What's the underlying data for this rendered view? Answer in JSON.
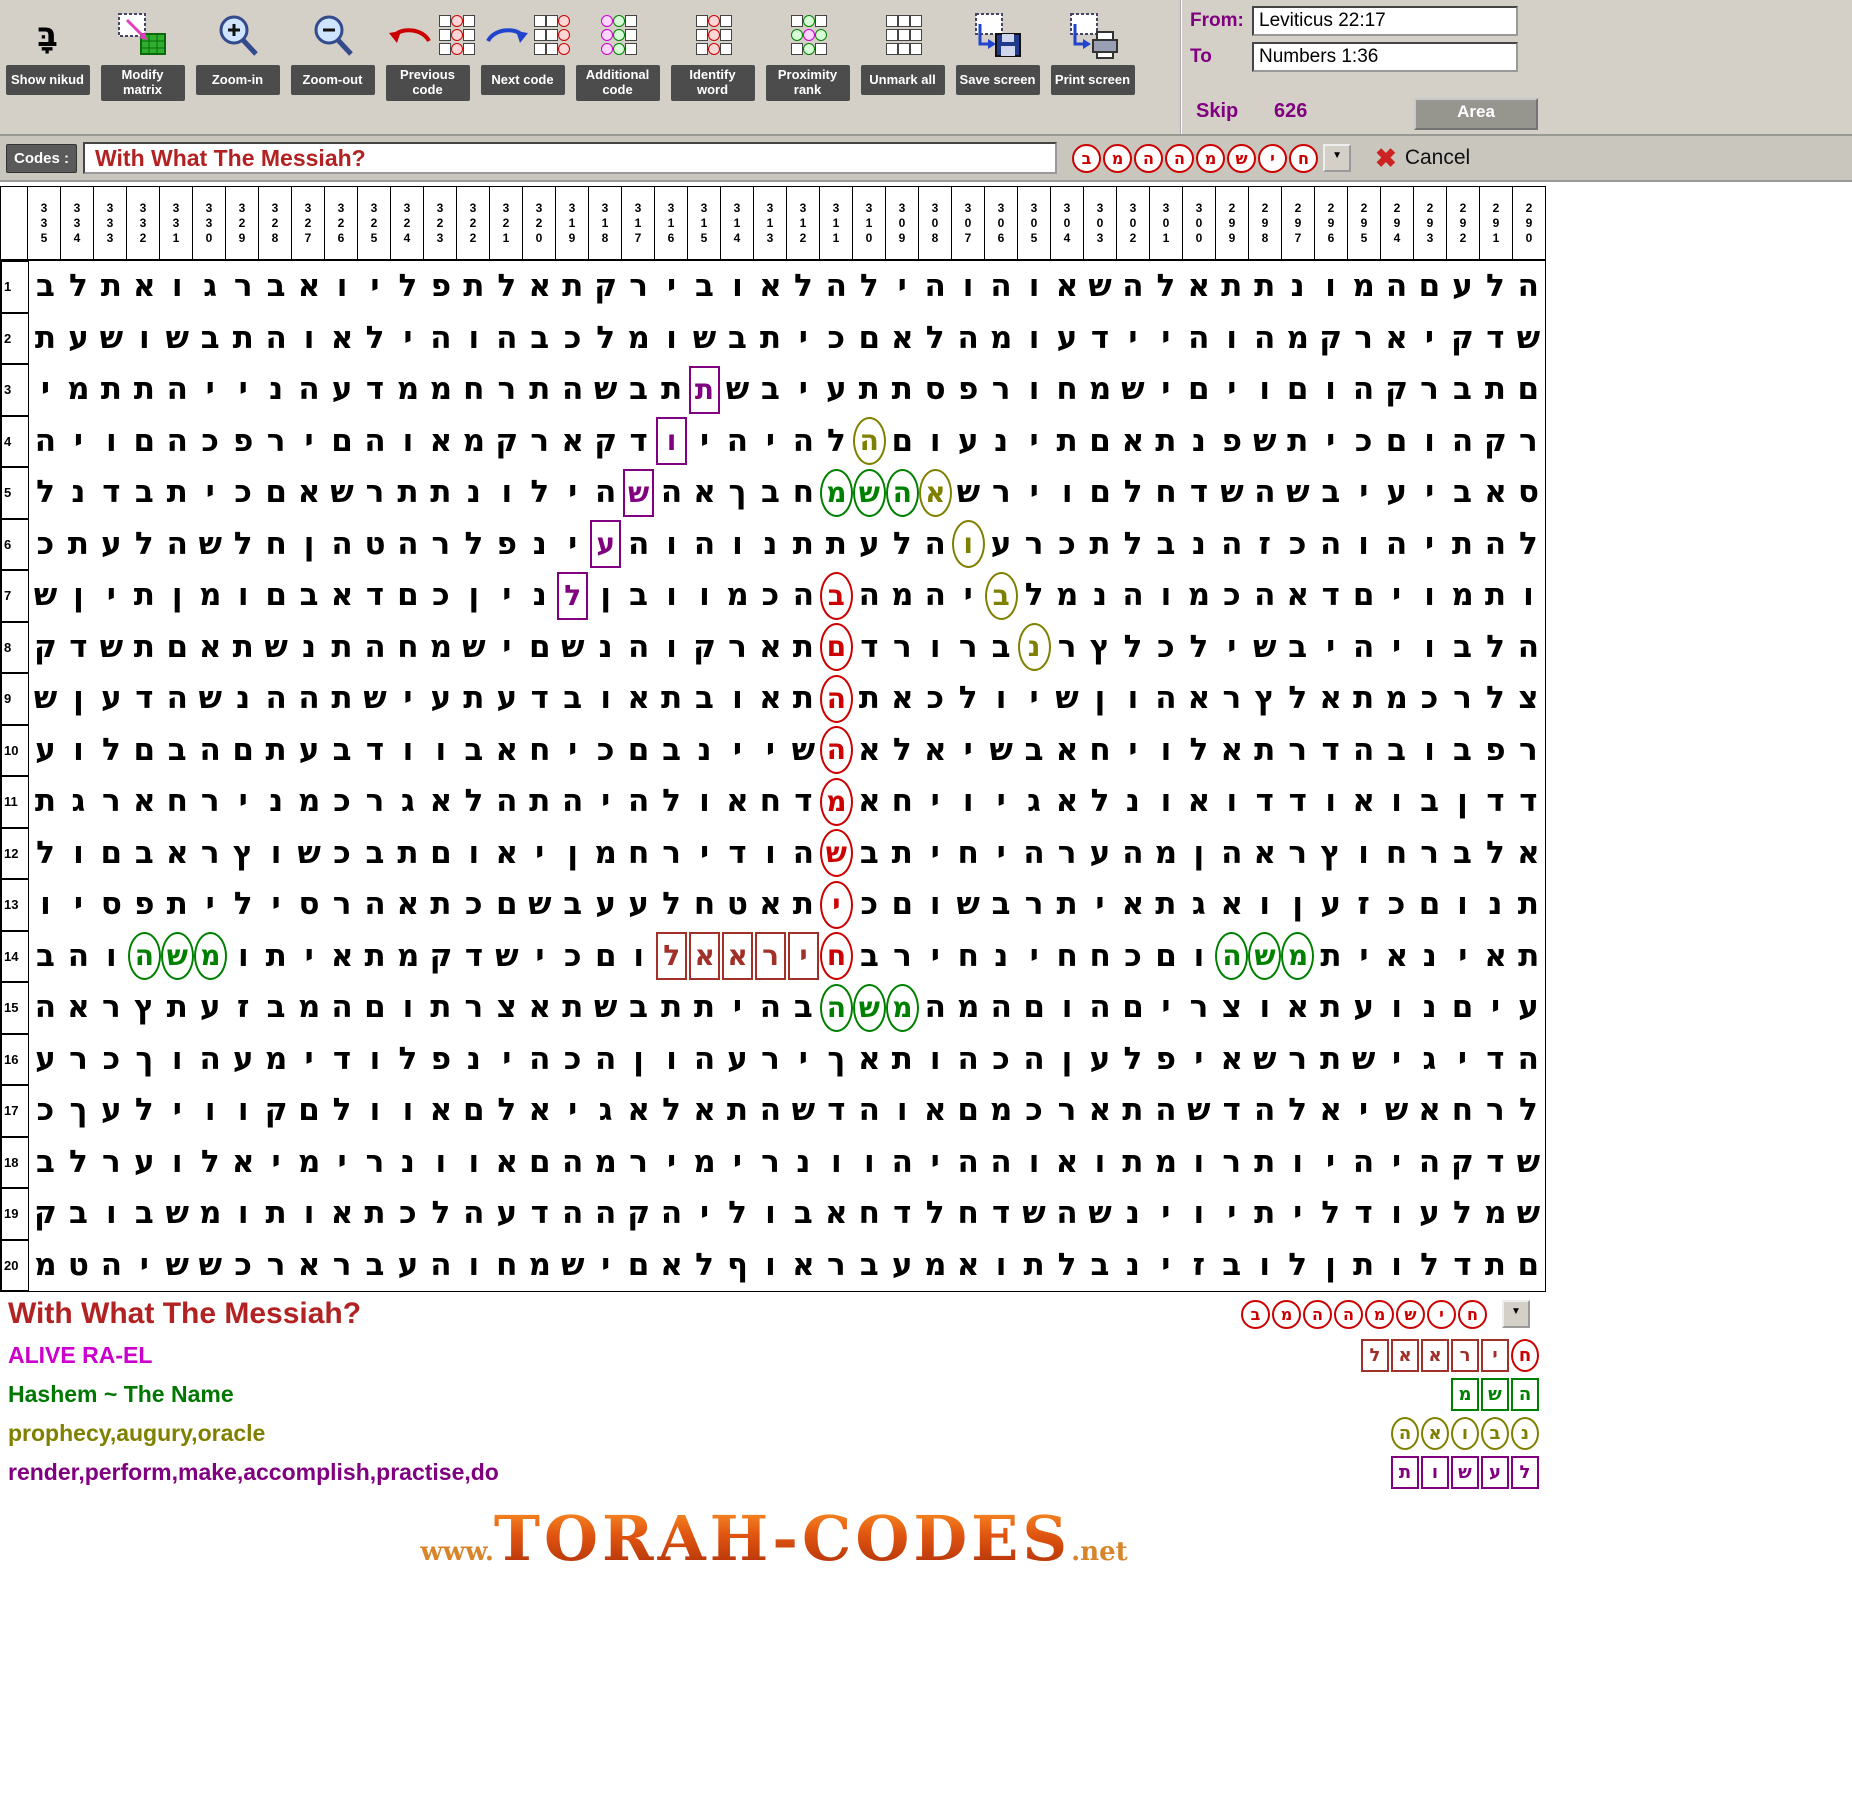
{
  "toolbar": {
    "nikud_glyph": "בָּ",
    "buttons": [
      {
        "id": "show-nikud",
        "label": "Show nikud"
      },
      {
        "id": "modify-matrix",
        "label": "Modify matrix"
      },
      {
        "id": "zoom-in",
        "label": "Zoom-in"
      },
      {
        "id": "zoom-out",
        "label": "Zoom-out"
      },
      {
        "id": "previous-code",
        "label": "Previous code"
      },
      {
        "id": "next-code",
        "label": "Next code"
      },
      {
        "id": "additional-code",
        "label": "Additional code"
      },
      {
        "id": "identify-word",
        "label": "Identify word"
      },
      {
        "id": "proximity-rank",
        "label": "Proximity rank"
      },
      {
        "id": "unmark-all",
        "label": "Unmark all"
      },
      {
        "id": "save-screen",
        "label": "Save screen"
      },
      {
        "id": "print-screen",
        "label": "Print screen"
      }
    ]
  },
  "range": {
    "from_label": "From:",
    "from_value": "Leviticus 22:17",
    "to_label": "To",
    "to_value": "Numbers 1:36",
    "skip_label": "Skip",
    "skip_value": "626",
    "area_label": "Area"
  },
  "codes_bar": {
    "label": "Codes :",
    "value": "With What The Messiah?",
    "code_letters": [
      "ב",
      "מ",
      "ה",
      "ה",
      "מ",
      "ש",
      "י",
      "ח"
    ],
    "cancel_label": "Cancel"
  },
  "colors": {
    "red": "#cc0000",
    "green": "#008000",
    "olive": "#808000",
    "purple": "#800080",
    "maroon": "#a03028"
  },
  "matrix": {
    "column_headers": [
      335,
      334,
      333,
      332,
      331,
      330,
      329,
      328,
      327,
      326,
      325,
      324,
      323,
      322,
      321,
      320,
      319,
      318,
      317,
      316,
      315,
      314,
      313,
      312,
      311,
      310,
      309,
      308,
      307,
      306,
      305,
      304,
      303,
      302,
      301,
      300,
      299,
      298,
      297,
      296,
      295,
      294,
      293,
      292,
      291,
      290
    ],
    "rows": [
      "בלתאוגרבאוילפתלאתקריבואלהליהוהואשהלאתתנומהםעלה",
      "תעשושבתהואליהוהבכלמושבתיכםאלהמועדייהוהמקראיקדש",
      "ימתתהיינהעדממחרתהשבתהשביעתתספרוחמשיםיוםוהקרבתם",
      "היוםהכפריםהואמקראקדשיהיהלכםועניתםאתנפשתיכםוהקר",
      "לנדבתיכםאשרתתנוליהוהאךבחמשהעשריוםלחדשהשביעיבאס",
      "כתעלהשלחןהטהרלפנייהוהונתתעלהמערכתלבנהזכהוהיתהל",
      "שןיתןמוםבאדםכןינתןבוומכהבהמהישלמנהומכהאדםיומתו",
      "קדשתםאתשנתהחמשיםשנהוקראתםדרורבארץלכלישביהיובלה",
      "שןעדהשנההתשיעתעדבואתבואתהתאכלוישןוהארץלאתמכרלצ",
      "עולםבהםתעבדוובאחיכםבניישראלאישבאחיולאתרדהבובפר",
      "תגראחרינמכרגאלהתהיהלואחדמאחיויגאלנואודדואובןדד",
      "לוםבארץושכבתםואיןמחרידוהשבתיחיהרעהמןהארץוחרבלא",
      "ויספתיליסרהאתכםשבעעלחטאתיכםושברתיאתגאוןעזכםונת",
      "בהוהשמותיאתמקדשיכםולאאריחבריחניחחכםוהשמתיאניאת",
      "הארץתעזבמהםותרצאתשבתתיהבהשמהמהםוהםירצואתעונםיע",
      "ערכךוהעמידולפניהכהןוהעריךאתוהכהןעלפיאשרתשיגידה",
      "כךעליווקםלוואםלאיגאלאתהשדהואםמכראתהשדהלאישאחרל",
      "בלרעולאימירנוואםהמרימירנווהיההואותמורתויהיהקדש",
      "קבובשמותואתכלהעדההקהילובאחדלחדשהשניויתילדועלמש",
      "מטהיששכרארבעהוחמשיםאלףוארבעמאותלבניזבולןתולדתם"
    ],
    "highlights": [
      {
        "r": 3,
        "c": 20,
        "ch": "ת",
        "color": "purple",
        "shape": "box"
      },
      {
        "r": 4,
        "c": 19,
        "ch": "ו",
        "color": "purple",
        "shape": "box"
      },
      {
        "r": 5,
        "c": 18,
        "ch": "ש",
        "color": "purple",
        "shape": "box"
      },
      {
        "r": 6,
        "c": 17,
        "ch": "ע",
        "color": "purple",
        "shape": "box"
      },
      {
        "r": 7,
        "c": 16,
        "ch": "ל",
        "color": "purple",
        "shape": "box"
      },
      {
        "r": 4,
        "c": 25,
        "ch": "ה",
        "color": "olive",
        "shape": "circle"
      },
      {
        "r": 5,
        "c": 27,
        "ch": "א",
        "color": "olive",
        "shape": "circle"
      },
      {
        "r": 6,
        "c": 28,
        "ch": "ו",
        "color": "olive",
        "shape": "circle"
      },
      {
        "r": 7,
        "c": 29,
        "ch": "ב",
        "color": "olive",
        "shape": "circle"
      },
      {
        "r": 8,
        "c": 30,
        "ch": "נ",
        "color": "olive",
        "shape": "circle"
      },
      {
        "r": 7,
        "c": 24,
        "ch": "ב",
        "color": "red",
        "shape": "circle"
      },
      {
        "r": 8,
        "c": 24,
        "ch": "ם",
        "color": "red",
        "shape": "circle"
      },
      {
        "r": 9,
        "c": 24,
        "ch": "ה",
        "color": "red",
        "shape": "circle"
      },
      {
        "r": 10,
        "c": 24,
        "ch": "ה",
        "color": "red",
        "shape": "circle"
      },
      {
        "r": 11,
        "c": 24,
        "ch": "מ",
        "color": "red",
        "shape": "circle"
      },
      {
        "r": 12,
        "c": 24,
        "ch": "ש",
        "color": "red",
        "shape": "circle"
      },
      {
        "r": 13,
        "c": 24,
        "ch": "י",
        "color": "red",
        "shape": "circle"
      },
      {
        "r": 14,
        "c": 24,
        "ch": "ח",
        "color": "red",
        "shape": "circle"
      },
      {
        "r": 14,
        "c": 19,
        "ch": "ל",
        "color": "maroon",
        "shape": "box"
      },
      {
        "r": 14,
        "c": 20,
        "ch": "א",
        "color": "maroon",
        "shape": "box"
      },
      {
        "r": 14,
        "c": 21,
        "ch": "א",
        "color": "maroon",
        "shape": "box"
      },
      {
        "r": 14,
        "c": 22,
        "ch": "ר",
        "color": "maroon",
        "shape": "box"
      },
      {
        "r": 14,
        "c": 23,
        "ch": "י",
        "color": "maroon",
        "shape": "box"
      },
      {
        "r": 5,
        "c": 24,
        "ch": "מ",
        "color": "green",
        "shape": "circle"
      },
      {
        "r": 5,
        "c": 25,
        "ch": "ש",
        "color": "green",
        "shape": "circle"
      },
      {
        "r": 5,
        "c": 26,
        "ch": "ה",
        "color": "green",
        "shape": "circle"
      },
      {
        "r": 14,
        "c": 3,
        "ch": "ה",
        "color": "green",
        "shape": "circle"
      },
      {
        "r": 14,
        "c": 4,
        "ch": "ש",
        "color": "green",
        "shape": "circle"
      },
      {
        "r": 14,
        "c": 5,
        "ch": "מ",
        "color": "green",
        "shape": "circle"
      },
      {
        "r": 14,
        "c": 36,
        "ch": "ה",
        "color": "green",
        "shape": "circle"
      },
      {
        "r": 14,
        "c": 37,
        "ch": "ש",
        "color": "green",
        "shape": "circle"
      },
      {
        "r": 14,
        "c": 38,
        "ch": "מ",
        "color": "green",
        "shape": "circle"
      },
      {
        "r": 15,
        "c": 24,
        "ch": "ה",
        "color": "green",
        "shape": "circle"
      },
      {
        "r": 15,
        "c": 25,
        "ch": "ש",
        "color": "green",
        "shape": "circle"
      },
      {
        "r": 15,
        "c": 26,
        "ch": "מ",
        "color": "green",
        "shape": "circle"
      }
    ]
  },
  "legend": {
    "title": "With What The Messiah?",
    "title_color": "#b22222",
    "entries": [
      {
        "text": "ALIVE RA-EL",
        "color": "#cc00cc",
        "glyphs": [
          {
            "ch": "ל",
            "shape": "box",
            "color": "maroon"
          },
          {
            "ch": "א",
            "shape": "box",
            "color": "maroon"
          },
          {
            "ch": "א",
            "shape": "box",
            "color": "maroon"
          },
          {
            "ch": "ר",
            "shape": "box",
            "color": "maroon"
          },
          {
            "ch": "י",
            "shape": "box",
            "color": "maroon"
          },
          {
            "ch": "ח",
            "shape": "circle",
            "color": "red"
          }
        ]
      },
      {
        "text": "Hashem ~ The Name",
        "color": "#007700",
        "glyphs": [
          {
            "ch": "מ",
            "shape": "box",
            "color": "green"
          },
          {
            "ch": "ש",
            "shape": "box",
            "color": "green"
          },
          {
            "ch": "ה",
            "shape": "box",
            "color": "green"
          }
        ]
      },
      {
        "text": "prophecy,augury,oracle",
        "color": "#808000",
        "glyphs": [
          {
            "ch": "ה",
            "shape": "circle",
            "color": "olive"
          },
          {
            "ch": "א",
            "shape": "circle",
            "color": "olive"
          },
          {
            "ch": "ו",
            "shape": "circle",
            "color": "olive"
          },
          {
            "ch": "ב",
            "shape": "circle",
            "color": "olive"
          },
          {
            "ch": "נ",
            "shape": "circle",
            "color": "olive"
          }
        ]
      },
      {
        "text": "render,perform,make,accomplish,practise,do",
        "color": "#800080",
        "glyphs": [
          {
            "ch": "ת",
            "shape": "box",
            "color": "purple"
          },
          {
            "ch": "ו",
            "shape": "box",
            "color": "purple"
          },
          {
            "ch": "ש",
            "shape": "box",
            "color": "purple"
          },
          {
            "ch": "ע",
            "shape": "box",
            "color": "purple"
          },
          {
            "ch": "ל",
            "shape": "box",
            "color": "purple"
          }
        ]
      }
    ]
  },
  "watermark": {
    "prefix": "www.",
    "main": "TORAH-CODES",
    "suffix": ".net"
  }
}
